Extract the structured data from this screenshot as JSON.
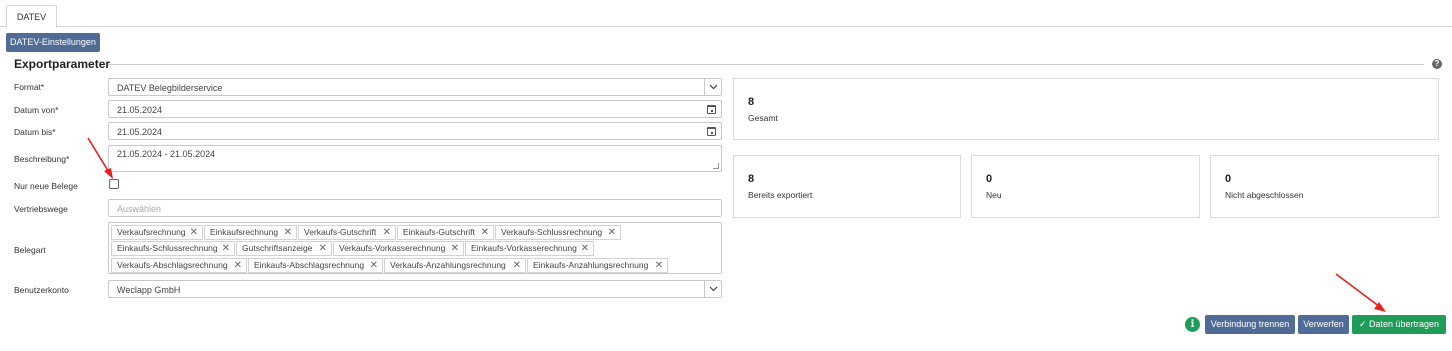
{
  "tabs": [
    {
      "label": "DATEV"
    }
  ],
  "toolbar": {
    "settings_label": "DATEV-Einstellungen"
  },
  "section": {
    "title": "Exportparameter"
  },
  "form": {
    "format": {
      "label": "Format*",
      "value": "DATEV Belegbilderservice"
    },
    "date_from": {
      "label": "Datum von*",
      "value": "21.05.2024"
    },
    "date_to": {
      "label": "Datum bis*",
      "value": "21.05.2024"
    },
    "description": {
      "label": "Beschreibung*",
      "value": "21.05.2024 - 21.05.2024"
    },
    "only_new": {
      "label": "Nur neue Belege",
      "checked": false
    },
    "sales_channels": {
      "label": "Vertriebswege",
      "placeholder": "Auswählen"
    },
    "document_types": {
      "label": "Belegart",
      "chips": [
        "Verkaufsrechnung",
        "Einkaufsrechnung",
        "Verkaufs-Gutschrift",
        "Einkaufs-Gutschrift",
        "Verkaufs-Schlussrechnung",
        "Einkaufs-Schlussrechnung",
        "Gutschriftsanzeige",
        "Verkaufs-Vorkasserechnung",
        "Einkaufs-Vorkasserechnung",
        "Verkaufs-Abschlagsrechnung",
        "Einkaufs-Abschlagsrechnung",
        "Verkaufs-Anzahlungsrechnung",
        "Einkaufs-Anzahlungsrechnung"
      ],
      "remove_glyph": "✕"
    },
    "user_account": {
      "label": "Benutzerkonto",
      "value": "Weclapp GmbH"
    }
  },
  "stats": {
    "total": {
      "value": "8",
      "label": "Gesamt"
    },
    "exported": {
      "value": "8",
      "label": "Bereits exportiert"
    },
    "new": {
      "value": "0",
      "label": "Neu"
    },
    "not_closed": {
      "value": "0",
      "label": "Nicht abgeschlossen"
    }
  },
  "actions": {
    "disconnect_label": "Verbindung trennen",
    "discard_label": "Verwerfen",
    "transfer_label": "Daten übertragen",
    "transfer_glyph": "✓",
    "info_glyph": "i",
    "help_glyph": "?"
  },
  "colors": {
    "slate_button": "#4f6b96",
    "green_button": "#1f9c58",
    "annotation_arrow": "#e8201c"
  }
}
